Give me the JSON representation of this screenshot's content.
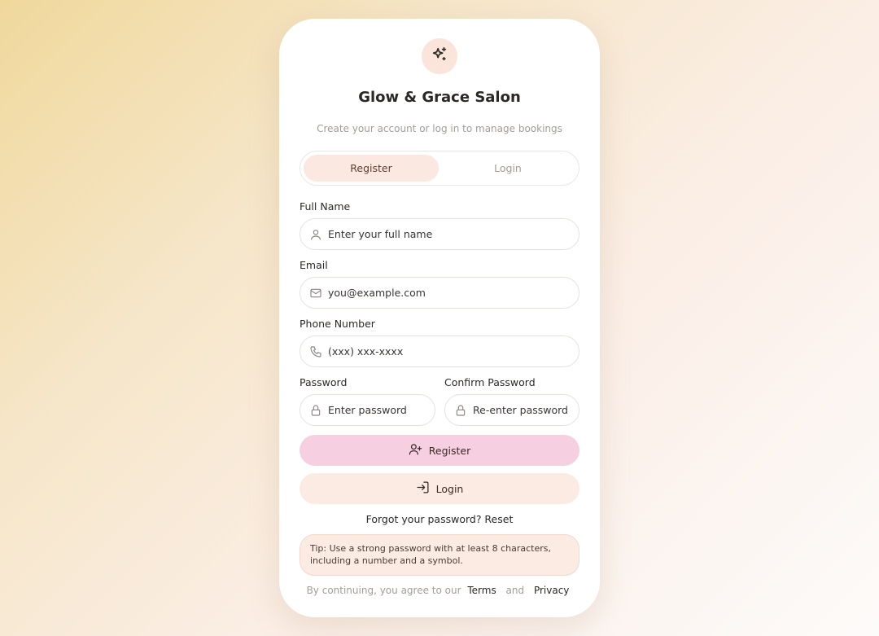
{
  "brand": {
    "logo_icon": "sparkles-icon",
    "title": "Glow & Grace Salon",
    "subtitle": "Create your account or log in to manage bookings"
  },
  "tabs": [
    {
      "label": "Register",
      "active": true
    },
    {
      "label": "Login",
      "active": false
    }
  ],
  "form": {
    "full_name": {
      "label": "Full Name",
      "placeholder": "Enter your full name",
      "icon": "user-icon"
    },
    "email": {
      "label": "Email",
      "placeholder": "you@example.com",
      "icon": "mail-icon"
    },
    "phone": {
      "label": "Phone Number",
      "placeholder": "(xxx) xxx-xxxx",
      "icon": "phone-icon"
    },
    "password": {
      "label": "Password",
      "placeholder": "Enter password",
      "icon": "lock-icon"
    },
    "confirm_password": {
      "label": "Confirm Password",
      "placeholder": "Re-enter password",
      "icon": "lock-icon"
    }
  },
  "buttons": {
    "register": {
      "label": "Register",
      "icon": "user-plus-icon"
    },
    "login": {
      "label": "Login",
      "icon": "log-in-icon"
    }
  },
  "forgot": "Forgot your password? Reset",
  "tip": "Tip: Use a strong password with at least 8 characters, including a number and a symbol.",
  "footer": {
    "prefix": "By continuing, you agree to our",
    "terms": "Terms",
    "and": "and",
    "privacy": "Privacy"
  },
  "colors": {
    "primary_button": "#f6cfe0",
    "secondary_button": "#fcebe3",
    "active_tab": "#fbe9e1"
  }
}
